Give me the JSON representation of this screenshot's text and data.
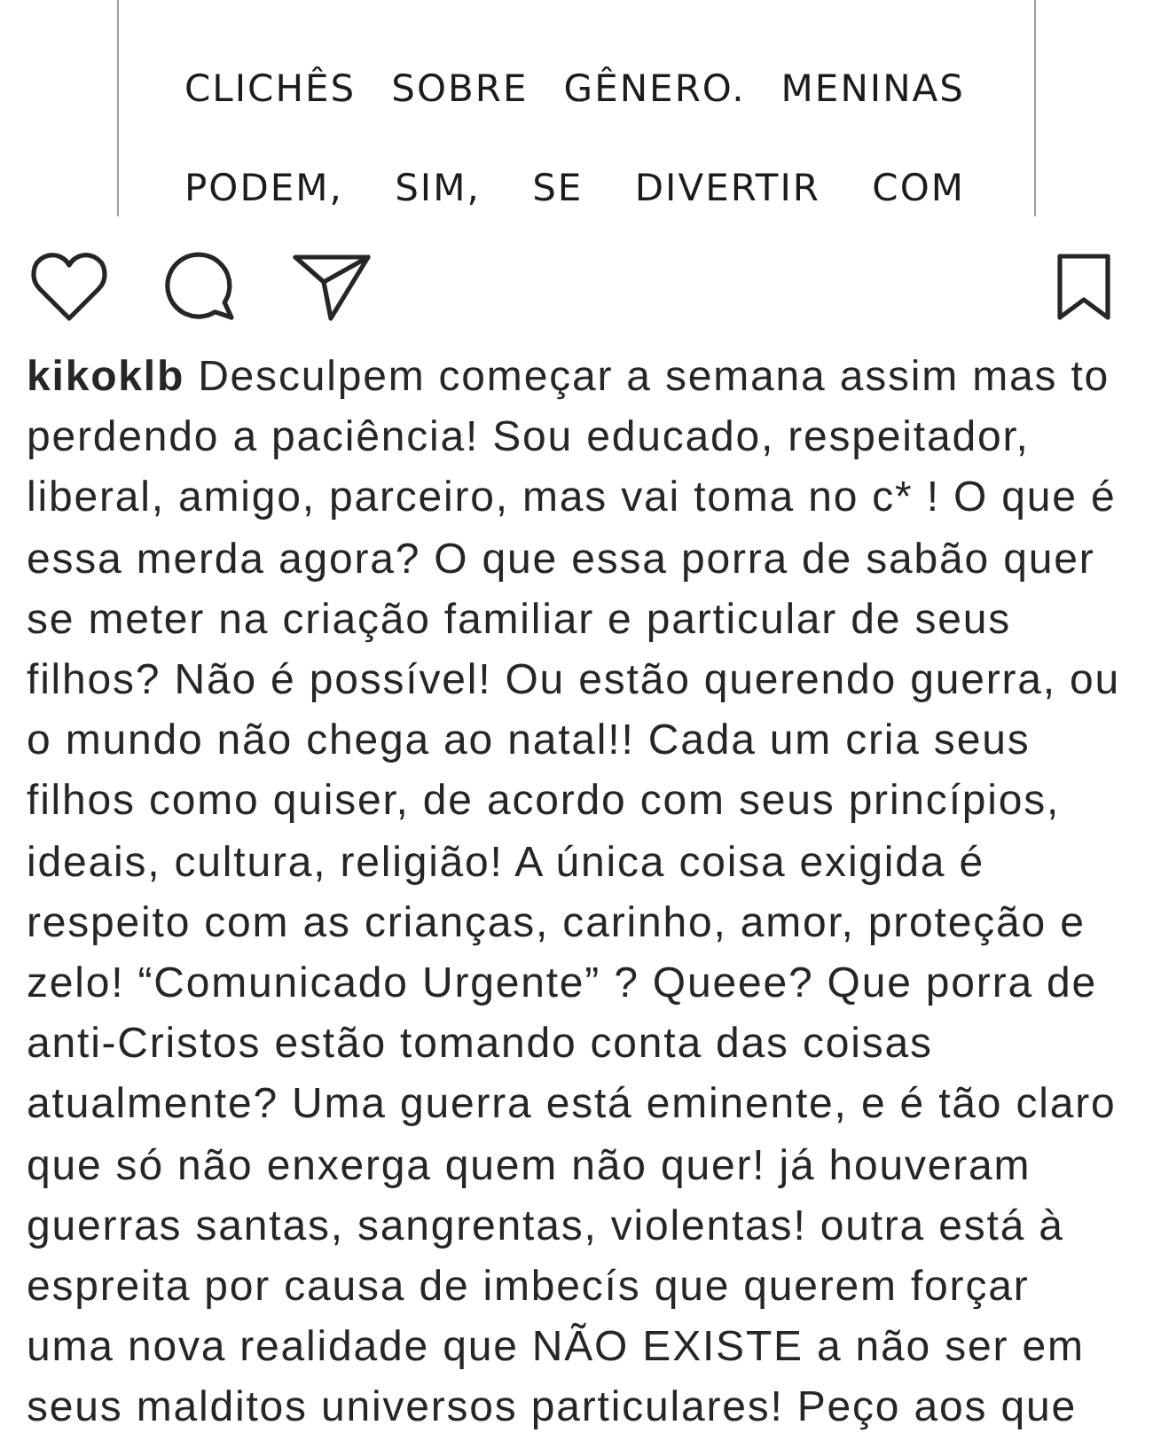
{
  "post_image": {
    "lines": [
      "CLICHÊS SOBRE GÊNERO. MENINAS",
      "PODEM, SIM, SE DIVERTIR COM"
    ]
  },
  "actions": {
    "liked": false,
    "saved": false
  },
  "caption": {
    "username": "kikoklb",
    "text": "Desculpem começar a semana assim mas to perdendo a paciência! Sou educado, respeitador, liberal, amigo, parceiro, mas vai toma no c* ! O que é essa merda agora? O que essa porra de sabão quer se meter na criação familiar e particular de seus filhos? Não é possível! Ou estão querendo guerra, ou o mundo não chega ao natal!! Cada um cria seus filhos como quiser, de acordo com seus princípios, ideais, cultura, religião! A única coisa exigida é respeito com as crianças, carinho, amor, proteção e zelo! “Comunicado Urgente” ? Queee? Que porra de anti-Cristos estão tomando conta das coisas atualmente? Uma guerra está eminente, e é tão claro que só não enxerga quem não quer! já houveram guerras santas, sangrentas, violentas! outra está à espreita por causa de imbecís que querem forçar uma nova realidade que NÃO EXISTE a não ser em seus malditos universos particulares! Peço aos que"
  }
}
